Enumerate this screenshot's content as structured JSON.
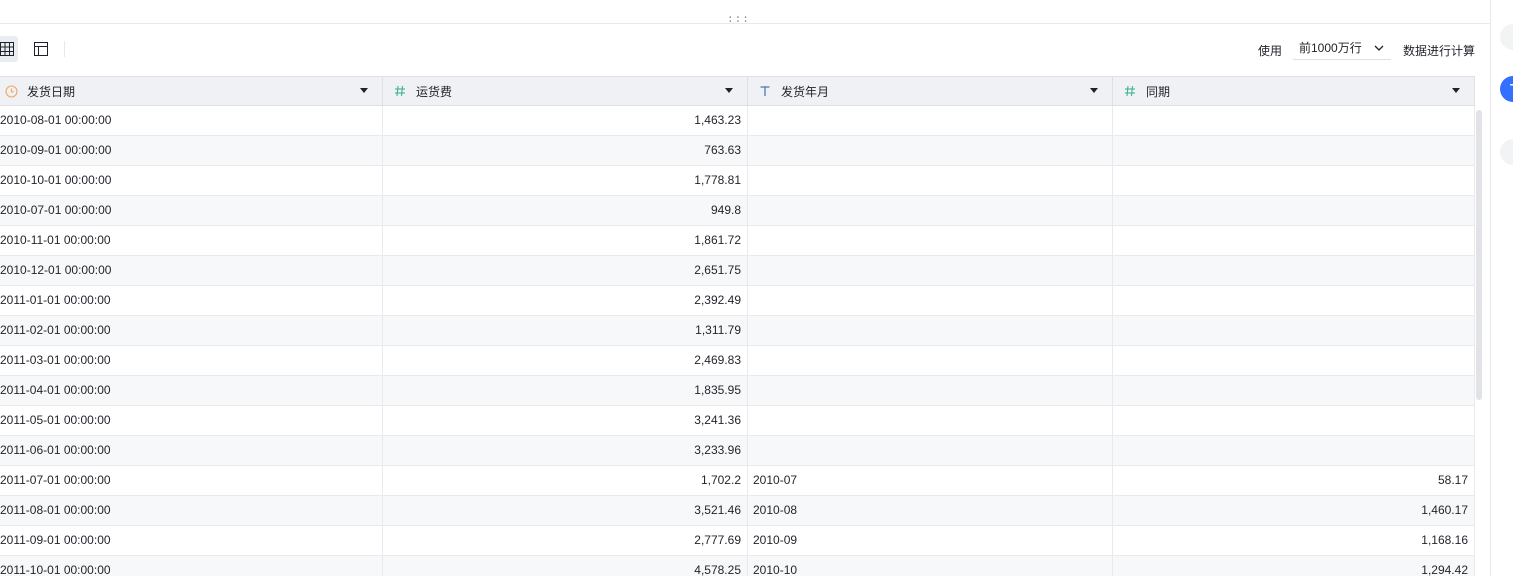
{
  "toolbar": {
    "use_label": "使用",
    "row_limit_value": "前1000万行",
    "calc_label": "数据进行计算"
  },
  "columns": [
    {
      "name": "发货日期",
      "type_icon": "clock-icon",
      "icon_color": "#f5a55d",
      "align": "left"
    },
    {
      "name": "运货费",
      "type_icon": "hash-icon",
      "icon_color": "#3fb68b",
      "align": "right"
    },
    {
      "name": "发货年月",
      "type_icon": "text-t-icon",
      "icon_color": "#4a6eb4",
      "align": "left"
    },
    {
      "name": "同期",
      "type_icon": "hash-icon",
      "icon_color": "#3fb68b",
      "align": "right"
    }
  ],
  "rows": [
    [
      "2010-08-01 00:00:00",
      "1,463.23",
      "",
      ""
    ],
    [
      "2010-09-01 00:00:00",
      "763.63",
      "",
      ""
    ],
    [
      "2010-10-01 00:00:00",
      "1,778.81",
      "",
      ""
    ],
    [
      "2010-07-01 00:00:00",
      "949.8",
      "",
      ""
    ],
    [
      "2010-11-01 00:00:00",
      "1,861.72",
      "",
      ""
    ],
    [
      "2010-12-01 00:00:00",
      "2,651.75",
      "",
      ""
    ],
    [
      "2011-01-01 00:00:00",
      "2,392.49",
      "",
      ""
    ],
    [
      "2011-02-01 00:00:00",
      "1,311.79",
      "",
      ""
    ],
    [
      "2011-03-01 00:00:00",
      "2,469.83",
      "",
      ""
    ],
    [
      "2011-04-01 00:00:00",
      "1,835.95",
      "",
      ""
    ],
    [
      "2011-05-01 00:00:00",
      "3,241.36",
      "",
      ""
    ],
    [
      "2011-06-01 00:00:00",
      "3,233.96",
      "",
      ""
    ],
    [
      "2011-07-01 00:00:00",
      "1,702.2",
      "2010-07",
      "58.17"
    ],
    [
      "2011-08-01 00:00:00",
      "3,521.46",
      "2010-08",
      "1,460.17"
    ],
    [
      "2011-09-01 00:00:00",
      "2,777.69",
      "2010-09",
      "1,168.16"
    ],
    [
      "2011-10-01 00:00:00",
      "4,578.25",
      "2010-10",
      "1,294.42"
    ]
  ],
  "side_panel": {
    "avatar_initial": "T"
  }
}
